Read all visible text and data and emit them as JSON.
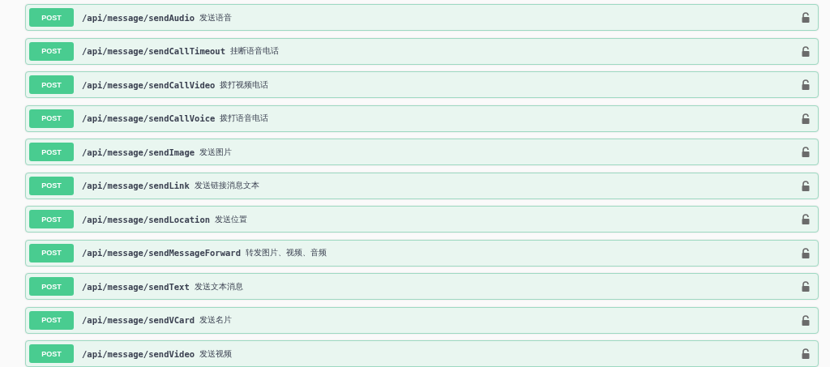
{
  "operations": [
    {
      "method": "POST",
      "path": "/api/message/sendAudio",
      "summary": "发送语音"
    },
    {
      "method": "POST",
      "path": "/api/message/sendCallTimeout",
      "summary": "挂断语音电话"
    },
    {
      "method": "POST",
      "path": "/api/message/sendCallVideo",
      "summary": "拨打视频电话"
    },
    {
      "method": "POST",
      "path": "/api/message/sendCallVoice",
      "summary": "拨打语音电话"
    },
    {
      "method": "POST",
      "path": "/api/message/sendImage",
      "summary": "发送图片"
    },
    {
      "method": "POST",
      "path": "/api/message/sendLink",
      "summary": "发送链接消息文本"
    },
    {
      "method": "POST",
      "path": "/api/message/sendLocation",
      "summary": "发送位置"
    },
    {
      "method": "POST",
      "path": "/api/message/sendMessageForward",
      "summary": "转发图片、视频、音频"
    },
    {
      "method": "POST",
      "path": "/api/message/sendText",
      "summary": "发送文本消息"
    },
    {
      "method": "POST",
      "path": "/api/message/sendVCard",
      "summary": "发送名片"
    },
    {
      "method": "POST",
      "path": "/api/message/sendVideo",
      "summary": "发送视频"
    }
  ]
}
